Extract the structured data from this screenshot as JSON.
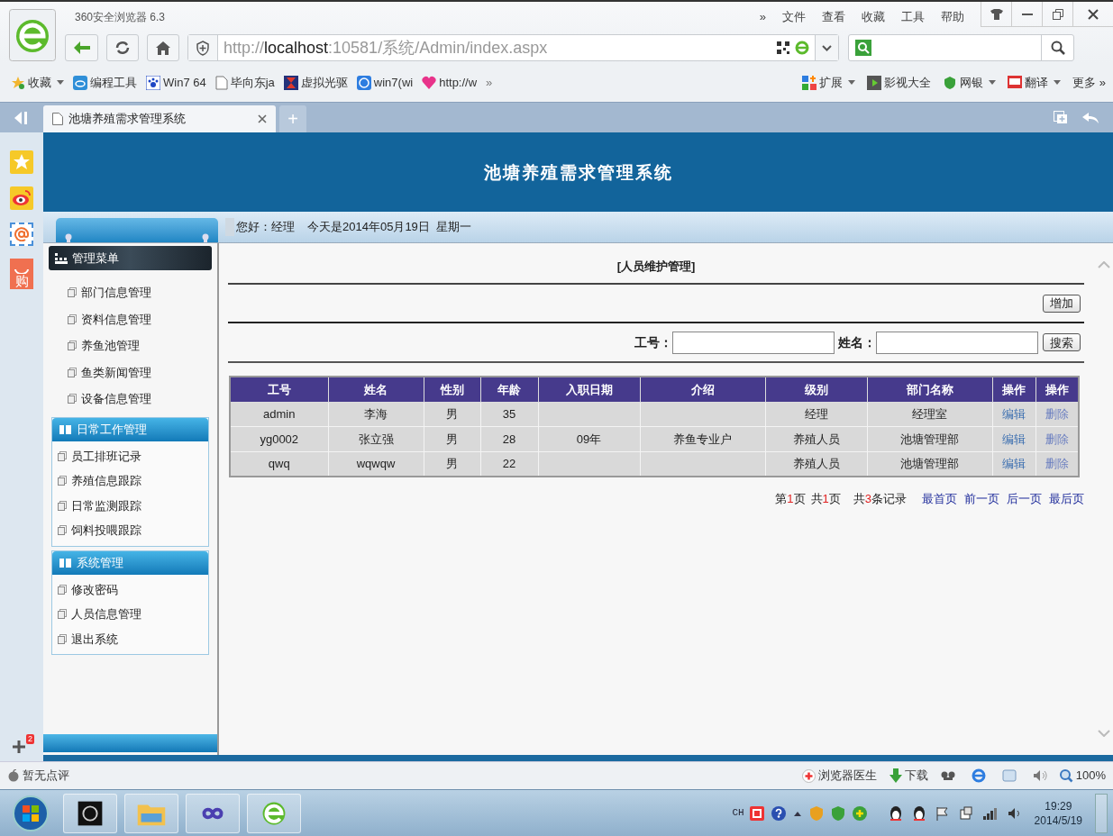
{
  "browser": {
    "title": "360安全浏览器 6.3",
    "menu": [
      "»",
      "文件",
      "查看",
      "收藏",
      "工具",
      "帮助"
    ],
    "address": {
      "scheme": "http://",
      "host": "localhost",
      "path": ":10581/系统/Admin/index.aspx"
    },
    "bookmarks": [
      {
        "label": "收藏",
        "kind": "star",
        "dropdown": true
      },
      {
        "label": "编程工具",
        "kind": "cloud",
        "dropdown": false
      },
      {
        "label": "Win7 64",
        "kind": "paw",
        "dropdown": false
      },
      {
        "label": "毕向东ja",
        "kind": "page",
        "dropdown": false
      },
      {
        "label": "虚拟光驱",
        "kind": "disc",
        "dropdown": false
      },
      {
        "label": "win7(wi",
        "kind": "globe",
        "dropdown": false
      },
      {
        "label": "http://w",
        "kind": "heart",
        "dropdown": false
      }
    ],
    "bookmarks_more": "»",
    "toolbar_right": [
      {
        "label": "扩展",
        "kind": "blocks",
        "dropdown": true
      },
      {
        "label": "影视大全",
        "kind": "film",
        "dropdown": false
      },
      {
        "label": "网银",
        "kind": "shield",
        "dropdown": true
      },
      {
        "label": "翻译",
        "kind": "book",
        "dropdown": true
      }
    ],
    "more": "更多 »",
    "tabs": [
      {
        "title": "池塘养殖需求管理系统",
        "selected": true
      }
    ],
    "new_tab": "+"
  },
  "side_panel": [
    {
      "kind": "favorite"
    },
    {
      "kind": "weibo"
    },
    {
      "kind": "mail"
    },
    {
      "kind": "shop",
      "label": "购"
    }
  ],
  "add_badge": "2",
  "page": {
    "title": "池塘养殖需求管理系统",
    "greeting": "您好：经理",
    "date": "今天是2014年05月19日  星期一",
    "menu_title": "管理菜单",
    "menu_items": [
      "部门信息管理",
      "资料信息管理",
      "养鱼池管理",
      "鱼类新闻管理",
      "设备信息管理"
    ],
    "sections": [
      {
        "title": "日常工作管理",
        "items": [
          "员工排班记录",
          "养殖信息跟踪",
          "日常监测跟踪",
          "饲料投喂跟踪"
        ]
      },
      {
        "title": "系统管理",
        "items": [
          "修改密码",
          "人员信息管理",
          "退出系统"
        ]
      }
    ],
    "content": {
      "heading": "[人员维护管理]",
      "add_button": "增加",
      "search_fields": [
        {
          "label": "工号："
        },
        {
          "label": "姓名："
        }
      ],
      "search_button": "搜索",
      "table": {
        "columns": [
          "工号",
          "姓名",
          "性别",
          "年龄",
          "入职日期",
          "介绍",
          "级别",
          "部门名称",
          "操作",
          "操作"
        ],
        "rows": [
          {
            "cells": [
              "admin",
              "李海",
              "男",
              "35",
              "",
              "",
              "经理",
              "经理室"
            ],
            "actions": [
              "编辑",
              "删除"
            ]
          },
          {
            "cells": [
              "yg0002",
              "张立强",
              "男",
              "28",
              "09年",
              "养鱼专业户",
              "养殖人员",
              "池塘管理部"
            ],
            "actions": [
              "编辑",
              "删除"
            ]
          },
          {
            "cells": [
              "qwq",
              "wqwqw",
              "男",
              "22",
              "",
              "",
              "养殖人员",
              "池塘管理部"
            ],
            "actions": [
              "编辑",
              "删除"
            ]
          }
        ]
      },
      "pager": {
        "info": [
          {
            "before": "第",
            "number": "1",
            "after": "页"
          },
          {
            "before": "共",
            "number": "1",
            "after": "页"
          },
          {
            "before": "共",
            "number": "3",
            "after": "条记录"
          }
        ],
        "links": [
          "最首页",
          "前一页",
          "后一页",
          "最后页"
        ]
      }
    }
  },
  "status_bar": {
    "rating": "暂无点评",
    "items": [
      {
        "kind": "doctor",
        "label": "浏览器医生"
      },
      {
        "kind": "download",
        "label": "下载"
      }
    ],
    "zoom": "100%"
  },
  "taskbar": {
    "ime": "CH",
    "time": "19:29",
    "date": "2014/5/19"
  }
}
